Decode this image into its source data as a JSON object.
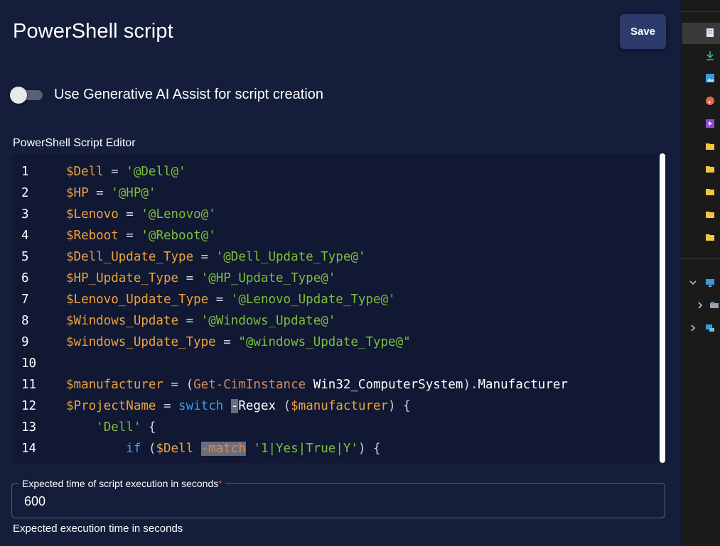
{
  "header": {
    "title": "PowerShell script",
    "save_label": "Save"
  },
  "ai_toggle": {
    "label": "Use Generative AI Assist for script creation",
    "enabled": false
  },
  "editor": {
    "label": "PowerShell Script Editor",
    "lines": [
      {
        "n": "1",
        "tokens": [
          [
            "var",
            "$Dell"
          ],
          [
            "pun",
            " = "
          ],
          [
            "str",
            "'@Dell@'"
          ]
        ]
      },
      {
        "n": "2",
        "tokens": [
          [
            "var",
            "$HP"
          ],
          [
            "pun",
            " = "
          ],
          [
            "str",
            "'@HP@'"
          ]
        ]
      },
      {
        "n": "3",
        "tokens": [
          [
            "var",
            "$Lenovo"
          ],
          [
            "pun",
            " = "
          ],
          [
            "str",
            "'@Lenovo@'"
          ]
        ]
      },
      {
        "n": "4",
        "tokens": [
          [
            "var",
            "$Reboot"
          ],
          [
            "pun",
            " = "
          ],
          [
            "str",
            "'@Reboot@'"
          ]
        ]
      },
      {
        "n": "5",
        "tokens": [
          [
            "var",
            "$Dell_Update_Type"
          ],
          [
            "pun",
            " = "
          ],
          [
            "str",
            "'@Dell_Update_Type@'"
          ]
        ]
      },
      {
        "n": "6",
        "tokens": [
          [
            "var",
            "$HP_Update_Type"
          ],
          [
            "pun",
            " = "
          ],
          [
            "str",
            "'@HP_Update_Type@'"
          ]
        ]
      },
      {
        "n": "7",
        "tokens": [
          [
            "var",
            "$Lenovo_Update_Type"
          ],
          [
            "pun",
            " = "
          ],
          [
            "str",
            "'@Lenovo_Update_Type@'"
          ]
        ]
      },
      {
        "n": "8",
        "tokens": [
          [
            "var",
            "$Windows_Update"
          ],
          [
            "pun",
            " = "
          ],
          [
            "str",
            "'@Windows_Update@'"
          ]
        ]
      },
      {
        "n": "9",
        "tokens": [
          [
            "var",
            "$windows_Update_Type"
          ],
          [
            "pun",
            " = "
          ],
          [
            "str",
            "\"@windows_Update_Type@\""
          ]
        ]
      },
      {
        "n": "10",
        "tokens": []
      },
      {
        "n": "11",
        "tokens": [
          [
            "var",
            "$manufacturer"
          ],
          [
            "pun",
            " = ("
          ],
          [
            "fn",
            "Get-CimInstance"
          ],
          [
            "wht",
            " Win32_ComputerSystem"
          ],
          [
            "pun",
            ")."
          ],
          [
            "wht",
            "Manufacturer"
          ]
        ]
      },
      {
        "n": "12",
        "tokens": [
          [
            "var",
            "$ProjectName"
          ],
          [
            "pun",
            " = "
          ],
          [
            "kw",
            "switch"
          ],
          [
            "pun",
            " "
          ],
          [
            "hl",
            "-"
          ],
          [
            "wht",
            "Regex"
          ],
          [
            "pun",
            " ("
          ],
          [
            "var",
            "$manufacturer"
          ],
          [
            "pun",
            ") {"
          ]
        ]
      },
      {
        "n": "13",
        "tokens": [
          [
            "pun",
            "    "
          ],
          [
            "str",
            "'Dell'"
          ],
          [
            "pun",
            " {"
          ]
        ]
      },
      {
        "n": "14",
        "tokens": [
          [
            "pun",
            "        "
          ],
          [
            "kw",
            "if"
          ],
          [
            "pun",
            " ("
          ],
          [
            "var",
            "$Dell"
          ],
          [
            "pun",
            " "
          ],
          [
            "hlfn",
            "-match"
          ],
          [
            "pun",
            " "
          ],
          [
            "str",
            "'1|Yes|True|Y'"
          ],
          [
            "pun",
            ") {"
          ]
        ]
      }
    ]
  },
  "execution_time": {
    "label": "Expected time of script execution in seconds",
    "required_marker": "*",
    "value": "600",
    "helper": "Expected execution time in seconds"
  },
  "side_panel": {
    "icons": [
      "document-icon",
      "download-icon",
      "image-icon",
      "music-icon",
      "video-icon",
      "folder-icon",
      "folder-icon",
      "folder-icon",
      "folder-icon",
      "folder-icon",
      "computer-icon",
      "drive-icon",
      "network-icon"
    ],
    "colors": {
      "folder": "#f4c542",
      "download": "#3fbf7f",
      "selected_bg": "#3a3a3a"
    }
  }
}
